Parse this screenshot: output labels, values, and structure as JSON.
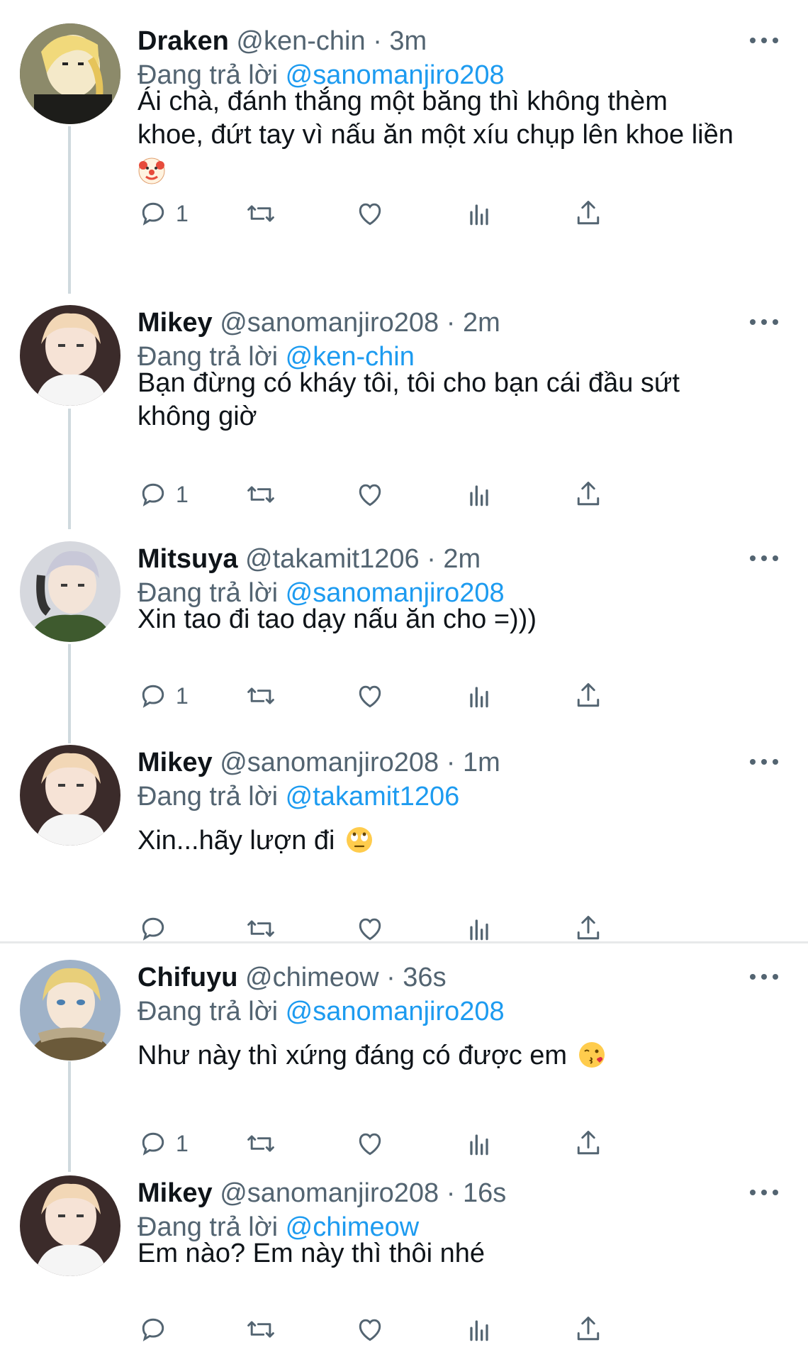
{
  "colors": {
    "text": "#0f1419",
    "muted": "#536471",
    "link": "#1d9bf0",
    "line": "#cfd9de"
  },
  "reply_prefix": "Đang trả lời",
  "tweets": [
    {
      "name": "Draken",
      "handle": "@ken-chin",
      "sep": "·",
      "time": "3m",
      "reply_to": "@sanomanjiro208",
      "text_lines": [
        "Ái chà, đánh thắng một băng thì không thèm",
        "khoe, đứt tay vì nấu ăn một xíu chụp lên khoe liền"
      ],
      "emoji": "clown-face",
      "reply_count": "1",
      "avatar": "draken-avatar"
    },
    {
      "name": "Mikey",
      "handle": "@sanomanjiro208",
      "sep": "·",
      "time": "2m",
      "reply_to": "@ken-chin",
      "text_lines": [
        "Bạn đừng có kháy tôi, tôi cho bạn cái đầu sứt",
        "không giờ"
      ],
      "reply_count": "1",
      "avatar": "mikey-avatar"
    },
    {
      "name": "Mitsuya",
      "handle": "@takamit1206",
      "sep": "·",
      "time": "2m",
      "reply_to": "@sanomanjiro208",
      "text_lines": [
        "Xin tao đi tao dạy nấu ăn cho =)))"
      ],
      "reply_count": "1",
      "avatar": "mitsuya-avatar"
    },
    {
      "name": "Mikey",
      "handle": "@sanomanjiro208",
      "sep": "·",
      "time": "1m",
      "reply_to": "@takamit1206",
      "text_lines": [
        "Xin...hãy lượn đi"
      ],
      "emoji": "rolling-eyes",
      "reply_count": "",
      "avatar": "mikey-avatar"
    },
    {
      "name": "Chifuyu",
      "handle": "@chimeow",
      "sep": "·",
      "time": "36s",
      "reply_to": "@sanomanjiro208",
      "text_lines": [
        "Như này thì xứng đáng có được em"
      ],
      "emoji": "kissing-face",
      "reply_count": "1",
      "avatar": "chifuyu-avatar"
    },
    {
      "name": "Mikey",
      "handle": "@sanomanjiro208",
      "sep": "·",
      "time": "16s",
      "reply_to": "@chimeow",
      "text_lines": [
        "Em nào? Em này thì thôi nhé"
      ],
      "reply_count": "",
      "avatar": "mikey-avatar"
    }
  ]
}
